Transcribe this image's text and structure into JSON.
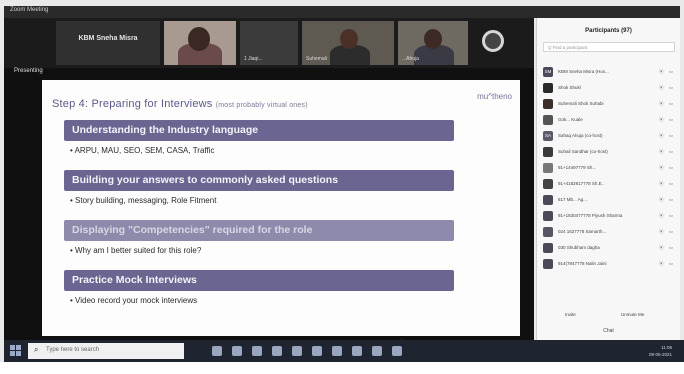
{
  "window": {
    "title": "Zoom Meeting"
  },
  "video_strip": {
    "tiles": [
      {
        "label": "",
        "name_display": "KBM Sneha Misra"
      },
      {
        "label": ""
      },
      {
        "label": "1 Jiaqi..."
      },
      {
        "label": "Suhemali"
      },
      {
        "label": "...Ahuja"
      }
    ]
  },
  "share": {
    "label": "Presenting"
  },
  "slide": {
    "title": "Step 4: Preparing for Interviews",
    "subtitle": "(most probably virtual ones)",
    "brand": "mu^theno",
    "sections": [
      {
        "heading": "Understanding the Industry language",
        "bullet": "ARPU, MAU, SEO, SEM, CASA, Traffic"
      },
      {
        "heading": "Building your answers to commonly asked questions",
        "bullet": "Story building, messaging, Role Fitment"
      },
      {
        "heading": "Displaying \"Competencies\" required for the role",
        "bullet": "Why am I better suited for this role?"
      },
      {
        "heading": "Practice Mock Interviews",
        "bullet": "Video record your mock interviews"
      }
    ]
  },
  "participants_panel": {
    "title": "Participants (97)",
    "search_placeholder": "Q  Find a participant",
    "participants": [
      {
        "initials": "SM",
        "name": "KBM Sneha Misra (Hos..."
      },
      {
        "initials": "",
        "name": "Shok Shukl"
      },
      {
        "initials": "",
        "name": "Suhemali Shok Suhabi"
      },
      {
        "initials": "",
        "name": "Gok... Kuale"
      },
      {
        "initials": "SA",
        "name": "Sahaq Ahuja (co-host)"
      },
      {
        "initials": "",
        "name": "Suhail Sandhar (co-host)"
      },
      {
        "initials": "",
        "name": "91+14497779 Sh..."
      },
      {
        "initials": "",
        "name": "91+4182917778 Sh.E.."
      },
      {
        "initials": "",
        "name": "617 Mb... Ag..."
      },
      {
        "initials": "",
        "name": "91+1830477778 Piyush Sharma"
      },
      {
        "initials": "",
        "name": "024 1627778 Samarth..."
      },
      {
        "initials": "",
        "name": "030 Shubham dagha"
      },
      {
        "initials": "",
        "name": "914(7847778 Nalin Jaini"
      }
    ],
    "footer_buttons": [
      "Invite",
      "Unmute Me"
    ],
    "chat_label": "Chat"
  },
  "taskbar": {
    "search_text": "Type here to search",
    "clock_time": "11:08",
    "clock_date": "08-05-2021"
  },
  "colors": {
    "slide_header": "#6a6691",
    "slide_title": "#5a5a8a",
    "taskbar": "#1f2431",
    "meeting_bg": "#101010"
  }
}
